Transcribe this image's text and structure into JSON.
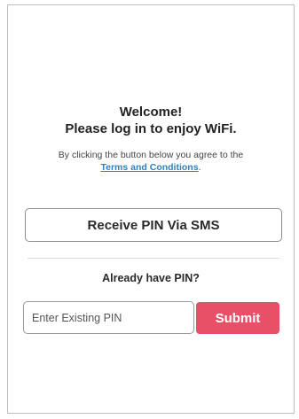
{
  "welcome": {
    "line1": "Welcome!",
    "line2": "Please log in to enjoy WiFi."
  },
  "agreement": {
    "text": "By clicking the button below you agree to the",
    "terms_link": "Terms and Conditions",
    "suffix": "."
  },
  "sms_button": {
    "label": "Receive PIN Via SMS"
  },
  "existing_pin": {
    "prompt": "Already have PIN?",
    "input_value": "",
    "input_placeholder": "Enter Existing PIN",
    "submit_label": "Submit"
  },
  "colors": {
    "submit_bg": "#e85068",
    "link": "#2f7fc1",
    "border": "#bdbdbd"
  }
}
